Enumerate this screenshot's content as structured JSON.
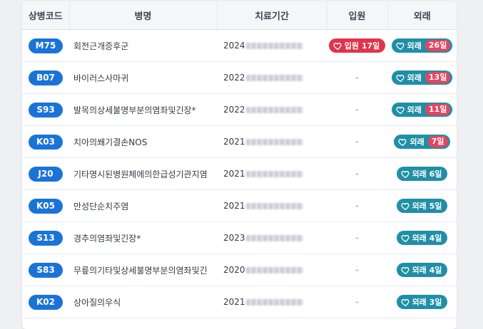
{
  "table": {
    "headers": {
      "code": "상병코드",
      "name": "병명",
      "period": "치료기간",
      "inpatient": "입원",
      "outpatient": "외래"
    },
    "inpatient_label": "입원",
    "outpatient_label": "외래",
    "rows": [
      {
        "code": "M75",
        "name": "회전근개증후군",
        "period_start": "2024",
        "inpatient": "17일",
        "outpatient": "26일"
      },
      {
        "code": "B07",
        "name": "바이러스사마귀",
        "period_start": "2022",
        "inpatient": "-",
        "outpatient": "13일"
      },
      {
        "code": "S93",
        "name": "발목의상세불명부분의염좌및긴장*",
        "period_start": "2022",
        "inpatient": "-",
        "outpatient": "11일"
      },
      {
        "code": "K03",
        "name": "치아의쐐기결손NOS",
        "period_start": "2021",
        "inpatient": "-",
        "outpatient": "7일"
      },
      {
        "code": "J20",
        "name": "기타명시된병원체에의한급성기관지염",
        "period_start": "2021",
        "inpatient": "-",
        "outpatient": "6일"
      },
      {
        "code": "K05",
        "name": "만성단순치주염",
        "period_start": "2021",
        "inpatient": "-",
        "outpatient": "5일"
      },
      {
        "code": "S13",
        "name": "경추의염좌및긴장*",
        "period_start": "2023",
        "inpatient": "-",
        "outpatient": "4일"
      },
      {
        "code": "S83",
        "name": "무릎의기타및상세불명부분의염좌및긴",
        "period_start": "2020",
        "inpatient": "-",
        "outpatient": "4일"
      },
      {
        "code": "K02",
        "name": "상아질의우식",
        "period_start": "2021",
        "inpatient": "-",
        "outpatient": "3일"
      }
    ]
  },
  "icons": {
    "heart": "heart-icon"
  },
  "colors": {
    "code_badge": "#1a73d9",
    "inpatient_pill": "#e0344c",
    "outpatient_pill": "#1f8fa6",
    "count_badge": "#e8445e"
  }
}
